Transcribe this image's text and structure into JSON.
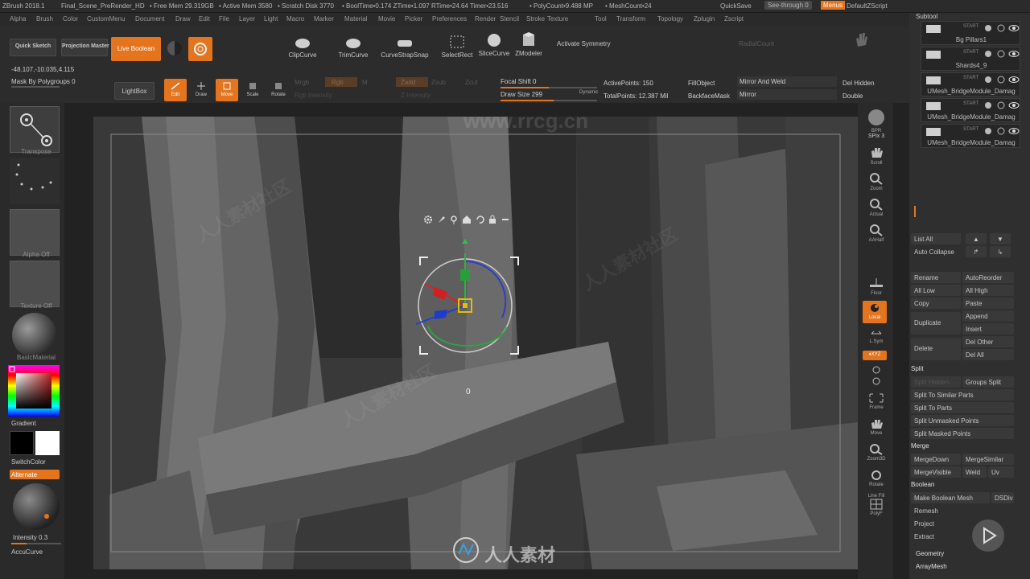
{
  "titlebar": {
    "app": "ZBrush 2018.1",
    "doc": "Final_Scene_PreRender_HD",
    "free_mem": "• Free Mem 29.319GB",
    "active_mem": "• Active Mem 3580",
    "scratch": "• Scratch Disk 3770",
    "booltime": "• BoolTime•0.174 ZTime•1.097 RTime•24.64 Timer•23.516",
    "polycount": "• PolyCount•9.488 MP",
    "meshcount": "• MeshCount•24",
    "quicksave": "QuickSave",
    "seethrough": "See-through 0",
    "menus": "Menus",
    "script": "DefaultZScript"
  },
  "menus": [
    "Alpha",
    "Brush",
    "Color",
    "CustomMenu",
    "Document",
    "Draw",
    "Edit",
    "File",
    "Layer",
    "Light",
    "Macro",
    "Marker",
    "Material",
    "Movie",
    "Picker",
    "Preferences",
    "Render",
    "Stencil",
    "Stroke",
    "Texture",
    "Tool",
    "Transform",
    "Topology",
    "Zplugin",
    "Zscript"
  ],
  "toolbar": {
    "quick_sketch": "Quick Sketch",
    "projection_master": "Projection Master",
    "live_boolean": "Live Boolean",
    "clip_curve": "ClipCurve",
    "trim_curve": "TrimCurve",
    "curve_strap": "CurveStrapSnap",
    "select_rect": "SelectRect",
    "slice_curve": "SliceCurve",
    "zmodeler": "ZModeler",
    "activate_symmetry": "Activate Symmetry",
    "radial_count": "RadialCount",
    "coords": "-48.107,-10.035,4.115",
    "mask_by_polygroups": "Mask By Polygroups 0",
    "lightbox": "LightBox",
    "edit": "Edit",
    "draw": "Draw",
    "move": "Move",
    "scale": "Scale",
    "rotate": "Rotate",
    "mrgb": "Mrgb",
    "rgb": "Rgb",
    "m": "M",
    "zadd": "Zadd",
    "zsub": "Zsub",
    "zcut": "Zcut",
    "rgb_intensity": "Rgb Intensity",
    "z_intensity": "Z Intensity",
    "focal_shift": "Focal Shift 0",
    "draw_size": "Draw Size 299",
    "dynamic": "Dynamic",
    "active_points": "ActivePoints: 150",
    "total_points": "TotalPoints: 12.387 Mil",
    "fill_object": "FillObject",
    "backface_mask": "BackfaceMask",
    "mirror_and_weld": "Mirror And Weld",
    "mirror": "Mirror",
    "del_hidden": "Del Hidden",
    "double": "Double"
  },
  "left": {
    "transpose": "Transpose",
    "alpha_off": "Alpha Off",
    "texture_off": "Texture Off",
    "basic_material": "BasicMaterial",
    "gradient": "Gradient",
    "switch_color": "SwitchColor",
    "alternate": "Alternate",
    "intensity": "Intensity 0.3",
    "intensity_value": 0.3,
    "accucurve": "AccuCurve"
  },
  "viewport": {
    "gizmo_readout": "0",
    "gizmo_icons": [
      "gear-icon",
      "pin-icon",
      "location-icon",
      "home-icon",
      "undo-icon",
      "lock-icon",
      "minus-icon"
    ]
  },
  "rightstrip": {
    "bpr": "BPR",
    "spix": "SPix 3",
    "scroll": "Scroll",
    "zoom": "Zoom",
    "actual": "Actual",
    "aahalf": "AAHalf",
    "floor": "Floor",
    "local": "Local",
    "lsym": "L.Sym",
    "xyz": "♦XYZ",
    "frame": "Frame",
    "move": "Move",
    "zoom3d": "Zoom3D",
    "rotate": "Rotate",
    "line_fill": "Line Fill",
    "polyf": "PolyF"
  },
  "subtool": {
    "header": "Subtool",
    "items": [
      {
        "name": "Bg Pillars1",
        "tag": "START"
      },
      {
        "name": "Shards4_9",
        "tag": "START"
      },
      {
        "name": "UMesh_BridgeModule_Damag",
        "tag": "START"
      },
      {
        "name": "UMesh_BridgeModule_Damag",
        "tag": "START"
      },
      {
        "name": "UMesh_BridgeModule_Damag",
        "tag": "START"
      }
    ],
    "list_all": "List All",
    "auto_collapse": "Auto Collapse",
    "rename": "Rename",
    "auto_reorder": "AutoReorder",
    "all_low": "All Low",
    "all_high": "All High",
    "copy": "Copy",
    "paste": "Paste",
    "duplicate": "Duplicate",
    "append": "Append",
    "insert": "Insert",
    "delete": "Delete",
    "del_other": "Del Other",
    "del_all": "Del All",
    "split": "Split",
    "split_hidden": "Split Hidden",
    "groups_split": "Groups Split",
    "split_similar": "Split To Similar Parts",
    "split_parts": "Split To Parts",
    "split_unmasked": "Split Unmasked Points",
    "split_masked": "Split Masked Points",
    "merge": "Merge",
    "merge_down": "MergeDown",
    "merge_similar": "MergeSimilar",
    "merge_visible": "MergeVisible",
    "weld": "Weld",
    "uv": "Uv",
    "boolean": "Boolean",
    "make_boolean_mesh": "Make Boolean Mesh",
    "dsdiv": "DSDiv",
    "remesh": "Remesh",
    "project": "Project",
    "extract": "Extract",
    "geometry": "Geometry",
    "array_mesh": "ArrayMesh"
  },
  "watermark": {
    "site": "www.rrcg.cn",
    "brand": "人人素材",
    "cn": "人人素材社区"
  },
  "colors": {
    "accent": "#e4741e",
    "panel": "#2c2c2c",
    "viewport_bg": "#3a3a3a"
  }
}
